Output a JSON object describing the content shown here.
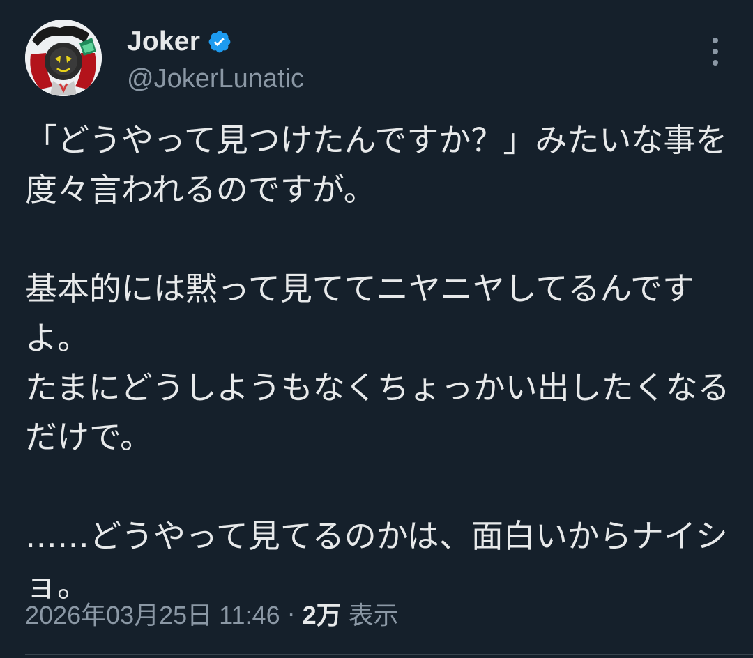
{
  "tweet": {
    "display_name": "Joker",
    "handle": "@JokerLunatic",
    "verified": true,
    "body": "「どうやって見つけたんですか？」みたいな事を度々言われるのですが。\n\n基本的には黙って見ててニヤニヤしてるんですよ。\nたまにどうしようもなくちょっかい出したくなるだけで。\n\n……どうやって見てるのかは、面白いからナイショ。",
    "date": "2026年03月25日 11:46",
    "separator": "·",
    "views_count": "2万",
    "views_label": "表示"
  },
  "icons": {
    "avatar": "joker-avatar",
    "verified": "verified-badge-icon",
    "more": "more-options-icon"
  },
  "colors": {
    "background": "#15202b",
    "text_primary": "#e7e9ea",
    "text_secondary": "#8b98a5",
    "verified_blue": "#1d9bf0",
    "divider": "#38444d"
  }
}
